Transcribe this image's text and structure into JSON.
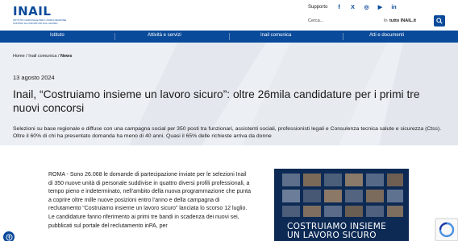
{
  "header": {
    "logo": "INAIL",
    "logo_sub": "ISTITUTO NAZIONALE PER L'ASSICURAZIONE CONTRO GLI INFORTUNI SUL LAVORO",
    "support": "Supporto",
    "socials": [
      "f",
      "X",
      "◎",
      "▶",
      "in"
    ],
    "search_placeholder": "Cerca...",
    "search_in": "In",
    "search_scope": "tutto INAIL.it"
  },
  "nav": [
    "Istituto",
    "Attività e servizi",
    "Inail comunica",
    "Atti e documenti"
  ],
  "breadcrumb": {
    "items": [
      "Home",
      "Inail comunica"
    ],
    "current": "News"
  },
  "article": {
    "date": "13 agosto 2024",
    "title": "Inail, “Costruiamo insieme un lavoro sicuro”: oltre 26mila candidature per i primi tre nuovi concorsi",
    "subtitle": "Selezioni su base regionale e diffuse con una campagna social per 350 posti tra funzionari, assistenti sociali, professionisti legali e Consulenza tecnica salute e sicurezza (Ctss). Oltre il 60% di chi ha presentato domanda ha meno di 40 anni. Quasi il 65% delle richieste arriva da donne",
    "body": "ROMA - Sono 26.068 le domande di partecipazione inviate per le selezioni Inail di 350 nuove unità di personale suddivise in quattro diversi profili professionali, a tempo pieno e indeterminato, nell’ambito della nuova programmazione che punta a coprire oltre mille nuove posizioni entro l’anno e della campagna di reclutamento “Costruiamo insieme un lavoro sicuro” lanciata lo scorso 12 luglio. Le candidature fanno riferimento ai primi tre bandi in scadenza dei nuovi sei, pubblicati sul portale del reclutamento inPA, per"
  },
  "promo": {
    "title_line1": "COSTRUIAMO INSIEME",
    "title_line2": "UN LAVORO SICURO"
  },
  "colors": {
    "brand": "#0a4a9a",
    "hero_bg": "#eceff3",
    "promo_bg": "#0d2a55"
  }
}
